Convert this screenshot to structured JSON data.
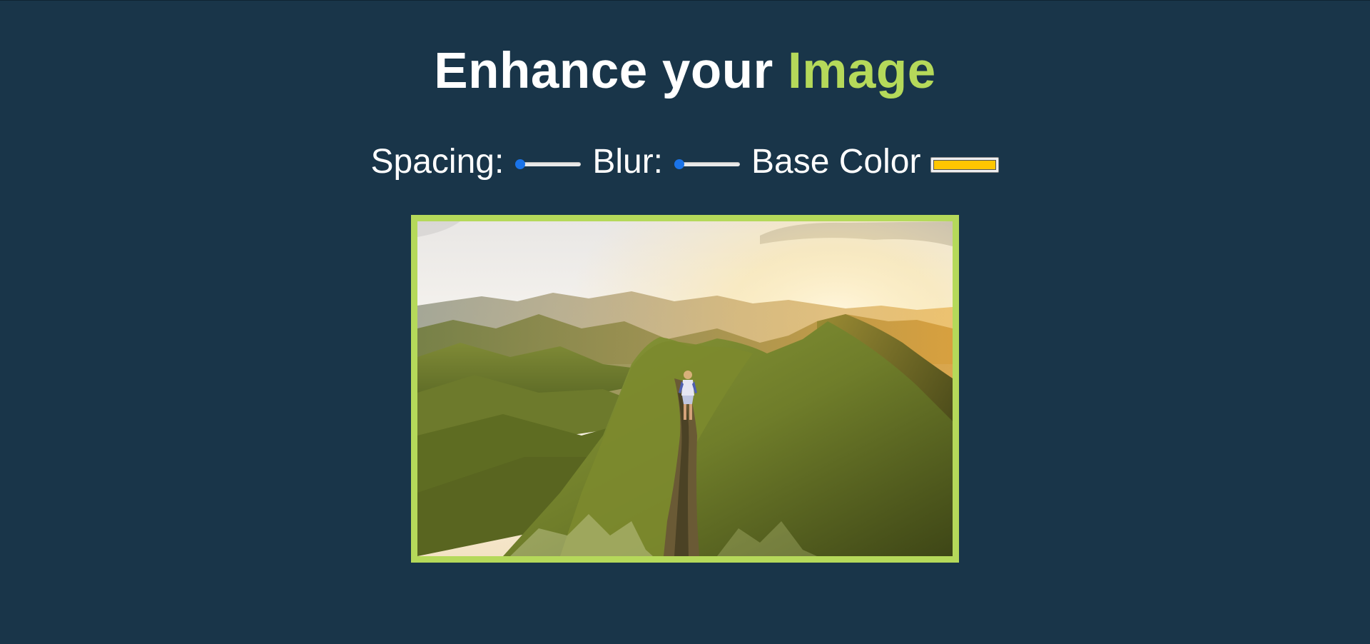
{
  "header": {
    "title_part1": "Enhance your",
    "title_accent": "Image"
  },
  "controls": {
    "spacing": {
      "label": "Spacing:",
      "value": 0
    },
    "blur": {
      "label": "Blur:",
      "value": 0
    },
    "base_color": {
      "label": "Base Color",
      "value": "#ffc600"
    }
  },
  "colors": {
    "background": "#193549",
    "accent": "#b5d95a",
    "base_color": "#ffc600"
  },
  "image": {
    "alt_subject": "hiker on mountain ridge at sunset"
  }
}
